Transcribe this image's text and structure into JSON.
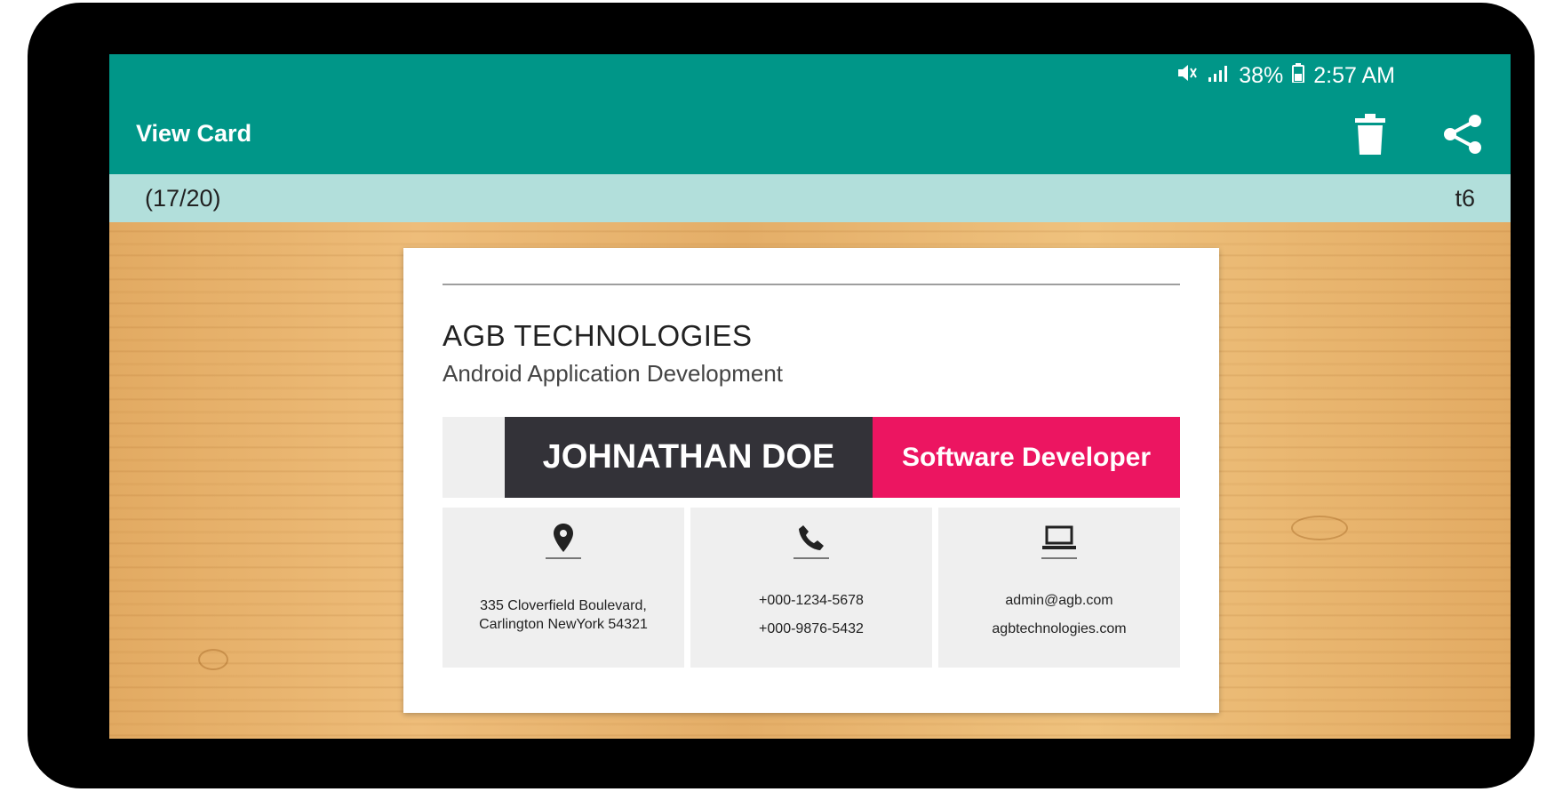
{
  "status_bar": {
    "battery": "38%",
    "time": "2:57 AM"
  },
  "app_bar": {
    "title": "View Card",
    "actions": [
      {
        "name": "delete",
        "icon": "trash-icon"
      },
      {
        "name": "share",
        "icon": "share-icon"
      }
    ]
  },
  "sub_bar": {
    "count": "(17/20)",
    "template": "t6"
  },
  "card": {
    "company": "AGB TECHNOLOGIES",
    "tagline": "Android Application Development",
    "name": "JOHNATHAN DOE",
    "role": "Software Developer",
    "address": {
      "icon": "location-pin-icon",
      "line1": "335 Cloverfield Boulevard,",
      "line2": "Carlington NewYork 54321"
    },
    "phone": {
      "icon": "phone-icon",
      "line1": "+000-1234-5678",
      "line2": "+000-9876-5432"
    },
    "web": {
      "icon": "laptop-icon",
      "line1": "admin@agb.com",
      "line2": "agbtechnologies.com"
    }
  },
  "colors": {
    "app_bar": "#009688",
    "sub_bar": "#b2dfdb",
    "name_band": "#333238",
    "role_band": "#ec1561",
    "info_cell": "#efefef",
    "wood": "#e7b26f"
  }
}
